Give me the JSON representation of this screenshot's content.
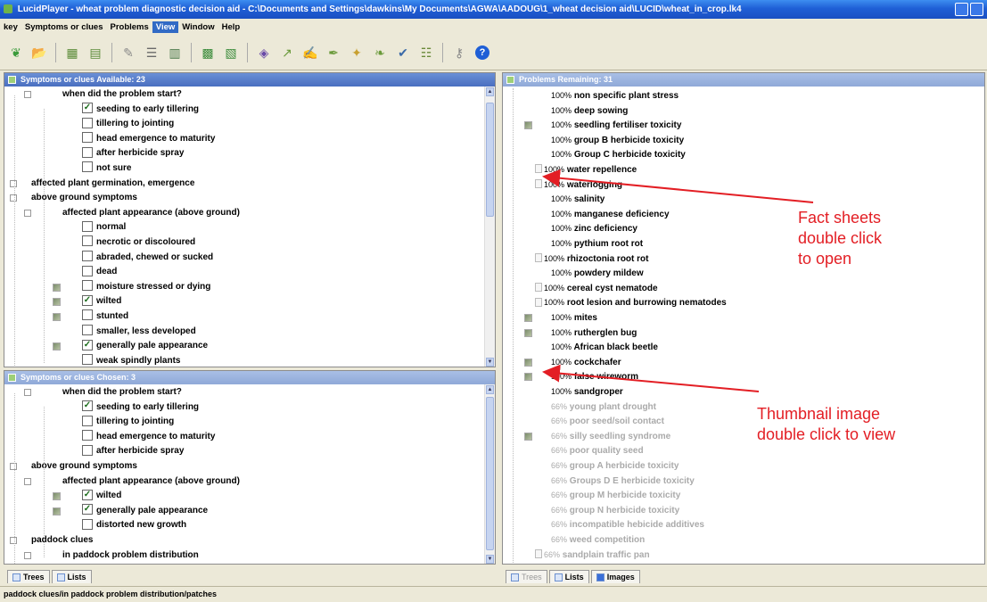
{
  "window": {
    "title": "LucidPlayer - wheat problem diagnostic decision aid - C:\\Documents and Settings\\dawkins\\My Documents\\AGWA\\AADOUG\\1_wheat decision aid\\LUCID\\wheat_in_crop.lk4"
  },
  "menu": [
    "key",
    "Symptoms or clues",
    "Problems",
    "View",
    "Window",
    "Help"
  ],
  "toolbar_icons": [
    "leaf-icon",
    "open-folder-icon",
    "tree-icon",
    "tree-alt-icon",
    "magic-wand-icon",
    "list-icon",
    "list-alt-icon",
    "compare-icon",
    "compare-alt-icon",
    "funnel-icon",
    "pen-icon",
    "pen-alt-icon",
    "pen-alt2-icon",
    "pin-icon",
    "leaf-pen-icon",
    "key-check-icon",
    "filter-list-icon",
    "key-icon",
    "help-icon"
  ],
  "available_pane": {
    "header": "Symptoms or clues Available: 23",
    "rows": [
      {
        "text": "when did the problem start?",
        "indent": 1,
        "check": null
      },
      {
        "text": "seeding to early tillering",
        "indent": 2,
        "check": true
      },
      {
        "text": "tillering to jointing",
        "indent": 2,
        "check": false
      },
      {
        "text": "head emergence to maturity",
        "indent": 2,
        "check": false
      },
      {
        "text": "after herbicide spray",
        "indent": 2,
        "check": false
      },
      {
        "text": "not sure",
        "indent": 2,
        "check": false
      },
      {
        "text": "affected plant germination, emergence",
        "indent": 0,
        "check": null
      },
      {
        "text": "above ground symptoms",
        "indent": 0,
        "check": null
      },
      {
        "text": "affected plant appearance (above ground)",
        "indent": 1,
        "check": null
      },
      {
        "text": "normal",
        "indent": 2,
        "check": false
      },
      {
        "text": "necrotic or discoloured",
        "indent": 2,
        "check": false
      },
      {
        "text": "abraded, chewed or sucked",
        "indent": 2,
        "check": false
      },
      {
        "text": "dead",
        "indent": 2,
        "check": false
      },
      {
        "text": "moisture stressed or dying",
        "indent": 2,
        "check": false,
        "img": true
      },
      {
        "text": "wilted",
        "indent": 2,
        "check": true,
        "img": true
      },
      {
        "text": "stunted",
        "indent": 2,
        "check": false,
        "img": true
      },
      {
        "text": "smaller, less developed",
        "indent": 2,
        "check": false
      },
      {
        "text": "generally pale appearance",
        "indent": 2,
        "check": true,
        "img": true
      },
      {
        "text": "weak spindly plants",
        "indent": 2,
        "check": false
      }
    ]
  },
  "chosen_pane": {
    "header": "Symptoms or clues Chosen: 3",
    "rows": [
      {
        "text": "when did the problem start?",
        "indent": 1,
        "check": null
      },
      {
        "text": "seeding to early tillering",
        "indent": 2,
        "check": true
      },
      {
        "text": "tillering to jointing",
        "indent": 2,
        "check": false
      },
      {
        "text": "head emergence to maturity",
        "indent": 2,
        "check": false
      },
      {
        "text": "after herbicide spray",
        "indent": 2,
        "check": false
      },
      {
        "text": "above ground symptoms",
        "indent": 0,
        "check": null
      },
      {
        "text": "affected plant appearance (above ground)",
        "indent": 1,
        "check": null
      },
      {
        "text": "wilted",
        "indent": 2,
        "check": true,
        "img": true
      },
      {
        "text": "generally pale appearance",
        "indent": 2,
        "check": true,
        "img": true
      },
      {
        "text": "distorted new growth",
        "indent": 2,
        "check": false
      },
      {
        "text": "paddock clues",
        "indent": 0,
        "check": null
      },
      {
        "text": "in paddock problem distribution",
        "indent": 1,
        "check": null
      }
    ]
  },
  "left_tabs": [
    "Trees",
    "Lists"
  ],
  "problems_pane": {
    "header": "Problems Remaining: 31",
    "rows": [
      {
        "pct": "100%",
        "name": "non specific plant stress",
        "icon": null
      },
      {
        "pct": "100%",
        "name": "deep sowing",
        "icon": null
      },
      {
        "pct": "100%",
        "name": "seedling fertiliser toxicity",
        "icon": "img"
      },
      {
        "pct": "100%",
        "name": "group B herbicide toxicity",
        "icon": null
      },
      {
        "pct": "100%",
        "name": "Group C herbicide toxicity",
        "icon": null
      },
      {
        "pct": "100%",
        "name": "water repellence",
        "icon": "doc"
      },
      {
        "pct": "100%",
        "name": "waterlogging",
        "icon": "doc"
      },
      {
        "pct": "100%",
        "name": "salinity",
        "icon": null
      },
      {
        "pct": "100%",
        "name": "manganese deficiency",
        "icon": null
      },
      {
        "pct": "100%",
        "name": "zinc deficiency",
        "icon": null
      },
      {
        "pct": "100%",
        "name": "pythium root rot",
        "icon": null
      },
      {
        "pct": "100%",
        "name": "rhizoctonia root rot",
        "icon": "doc"
      },
      {
        "pct": "100%",
        "name": "powdery mildew",
        "icon": null
      },
      {
        "pct": "100%",
        "name": "cereal cyst nematode",
        "icon": "doc"
      },
      {
        "pct": "100%",
        "name": "root lesion and burrowing nematodes",
        "icon": "doc"
      },
      {
        "pct": "100%",
        "name": "mites",
        "icon": "img"
      },
      {
        "pct": "100%",
        "name": "rutherglen bug",
        "icon": "img"
      },
      {
        "pct": "100%",
        "name": "African black beetle",
        "icon": null
      },
      {
        "pct": "100%",
        "name": "cockchafer",
        "icon": "img"
      },
      {
        "pct": "100%",
        "name": "false wireworm",
        "icon": "img"
      },
      {
        "pct": "100%",
        "name": "sandgroper",
        "icon": null
      },
      {
        "pct": "66%",
        "name": "young plant drought",
        "icon": null,
        "dim": true
      },
      {
        "pct": "66%",
        "name": "poor seed/soil contact",
        "icon": null,
        "dim": true
      },
      {
        "pct": "66%",
        "name": "silly seedling syndrome",
        "icon": "img",
        "dim": true
      },
      {
        "pct": "66%",
        "name": "poor quality seed",
        "icon": null,
        "dim": true
      },
      {
        "pct": "66%",
        "name": "group A herbicide toxicity",
        "icon": null,
        "dim": true
      },
      {
        "pct": "66%",
        "name": "Groups D E herbicide toxicity",
        "icon": null,
        "dim": true
      },
      {
        "pct": "66%",
        "name": "group M herbicide toxicity",
        "icon": null,
        "dim": true
      },
      {
        "pct": "66%",
        "name": "group N herbicide toxicity",
        "icon": null,
        "dim": true
      },
      {
        "pct": "66%",
        "name": "incompatible hebicide additives",
        "icon": null,
        "dim": true
      },
      {
        "pct": "66%",
        "name": "weed competition",
        "icon": null,
        "dim": true
      },
      {
        "pct": "66%",
        "name": "sandplain traffic pan",
        "icon": "doc",
        "dim": true
      }
    ]
  },
  "right_tabs": [
    "Trees",
    "Lists",
    "Images"
  ],
  "annotations": {
    "fact_sheets": [
      "Fact sheets",
      "double click",
      "to open"
    ],
    "thumbnail": [
      "Thumbnail image",
      "double click to view"
    ],
    "color": "#e31e24"
  },
  "status": "paddock clues/in paddock problem distribution/patches"
}
